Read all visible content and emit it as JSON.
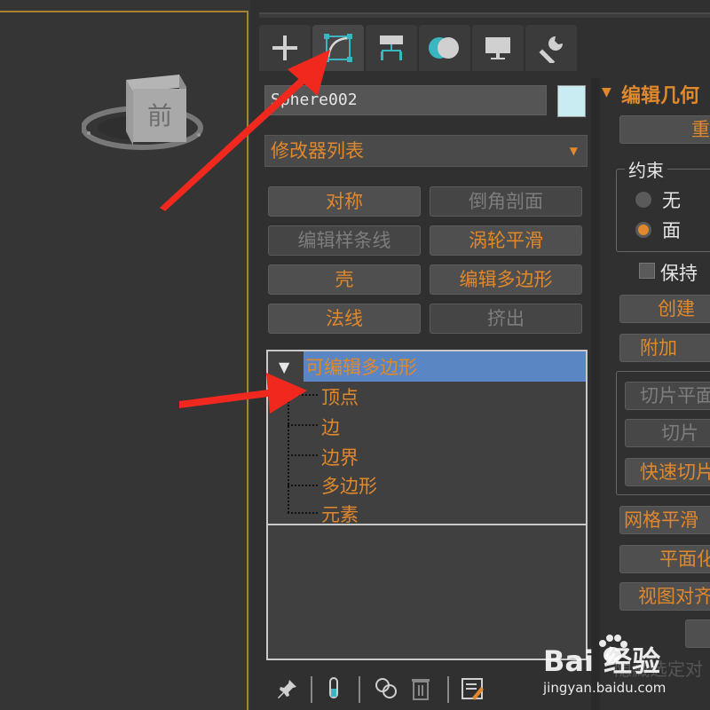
{
  "object_name": "Sphere002",
  "modifier_list_label": "修改器列表",
  "tabs": [
    {
      "name": "create",
      "icon": "plus-icon"
    },
    {
      "name": "modify",
      "icon": "modify-curve-icon",
      "active": true
    },
    {
      "name": "hierarchy",
      "icon": "hierarchy-icon"
    },
    {
      "name": "motion",
      "icon": "motion-icon"
    },
    {
      "name": "display",
      "icon": "monitor-icon"
    },
    {
      "name": "utilities",
      "icon": "wrench-icon"
    }
  ],
  "modifier_buttons": [
    {
      "label": "对称",
      "enabled": true
    },
    {
      "label": "倒角剖面",
      "enabled": false
    },
    {
      "label": "编辑样条线",
      "enabled": false
    },
    {
      "label": "涡轮平滑",
      "enabled": true
    },
    {
      "label": "壳",
      "enabled": true
    },
    {
      "label": "编辑多边形",
      "enabled": true
    },
    {
      "label": "法线",
      "enabled": true
    },
    {
      "label": "挤出",
      "enabled": false
    }
  ],
  "stack": {
    "title": "可编辑多边形",
    "items": [
      "顶点",
      "边",
      "边界",
      "多边形",
      "元素"
    ]
  },
  "viewcube_face": "前",
  "rollout": {
    "title": "编辑几何",
    "repeat_label": "重",
    "constraint_label": "约束",
    "constraint_none": "无",
    "constraint_face": "面",
    "preserve_label": "保持",
    "create_label": "创建",
    "attach_label": "附加",
    "slice_plane_label": "切片平面",
    "slice_label": "切片",
    "quick_slice_label": "快速切片",
    "meshsmooth_label": "网格平滑",
    "planarize_label": "平面化",
    "view_align_label": "视图对齐"
  },
  "colors": {
    "accent": "#e0882c",
    "swatch": "#c9ecf2",
    "stack_highlight": "#5a86c3",
    "arrow": "#f0281e"
  },
  "watermark": {
    "logo": "Bai 经验",
    "url": "jingyan.baidu.com",
    "faded_text": "隐藏选定对"
  }
}
